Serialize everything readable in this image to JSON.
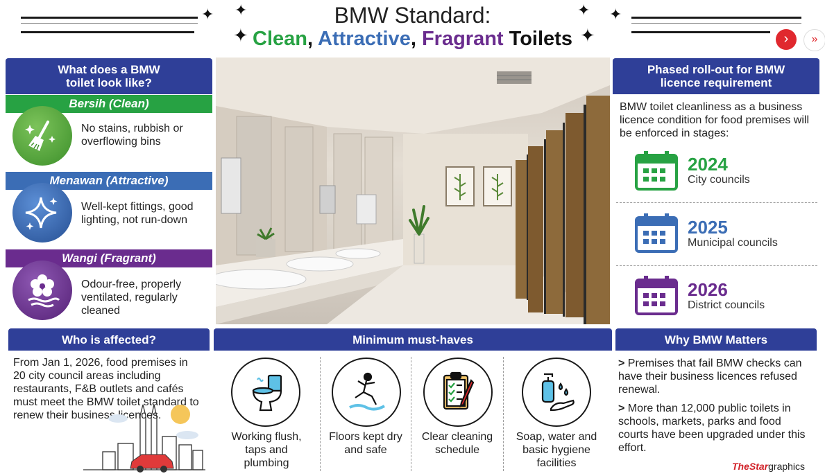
{
  "header": {
    "title_line1": "BMW Standard:",
    "title_clean": "Clean",
    "title_attractive": "Attractive",
    "title_fragrant": "Fragrant",
    "title_toilets": "Toilets",
    "comma": ",",
    "nav_next_symbol": "›",
    "nav_more_symbol": "»"
  },
  "left_panel": {
    "heading": "What does a BMW toilet look like?",
    "items": [
      {
        "label": "Bersih (Clean)",
        "text": "No stains, rubbish or overflowing bins",
        "icon": "broom-sparkle-icon",
        "color": "#27a243"
      },
      {
        "label": "Menawan (Attractive)",
        "text": "Well-kept fittings, good lighting, not run-down",
        "icon": "sparkle-stars-icon",
        "color": "#3b6db5"
      },
      {
        "label": "Wangi (Fragrant)",
        "text": "Odour-free, properly ventilated, regularly cleaned",
        "icon": "flower-breeze-icon",
        "color": "#6a2c8e"
      }
    ]
  },
  "right_panel": {
    "heading": "Phased roll-out for BMW licence requirement",
    "intro": "BMW toilet cleanliness as a business licence condition for food premises will be enforced in stages:",
    "phases": [
      {
        "year": "2024",
        "council": "City councils",
        "color": "#27a243"
      },
      {
        "year": "2025",
        "council": "Municipal councils",
        "color": "#3b6db5"
      },
      {
        "year": "2026",
        "council": "District councils",
        "color": "#6a2c8e"
      }
    ]
  },
  "affected": {
    "heading": "Who is affected?",
    "text": "From Jan 1, 2026, food premises in 20 city council areas including restaurants, F&B outlets and cafés must meet the BMW toilet standard to renew their business licences."
  },
  "must_haves": {
    "heading": "Minimum must-haves",
    "items": [
      {
        "label": "Working flush, taps and plumbing",
        "icon": "toilet-flush-icon"
      },
      {
        "label": "Floors kept dry and safe",
        "icon": "slip-hazard-icon"
      },
      {
        "label": "Clear cleaning schedule",
        "icon": "clipboard-checklist-icon"
      },
      {
        "label": "Soap, water and basic hygiene facilities",
        "icon": "soap-dispenser-icon"
      }
    ]
  },
  "why": {
    "heading": "Why BMW Matters",
    "bullets": [
      "Premises that fail BMW checks can have their business licences refused renewal.",
      "More than 12,000 public toilets in schools, markets, parks and food courts have been upgraded under this effort."
    ],
    "bullet_marker": ">"
  },
  "credit": {
    "brand": "TheStar",
    "suffix": "graphics"
  },
  "colors": {
    "navy": "#2f3f98",
    "green": "#27a243",
    "blue": "#3b6db5",
    "purple": "#6a2c8e",
    "red": "#e0282e"
  }
}
